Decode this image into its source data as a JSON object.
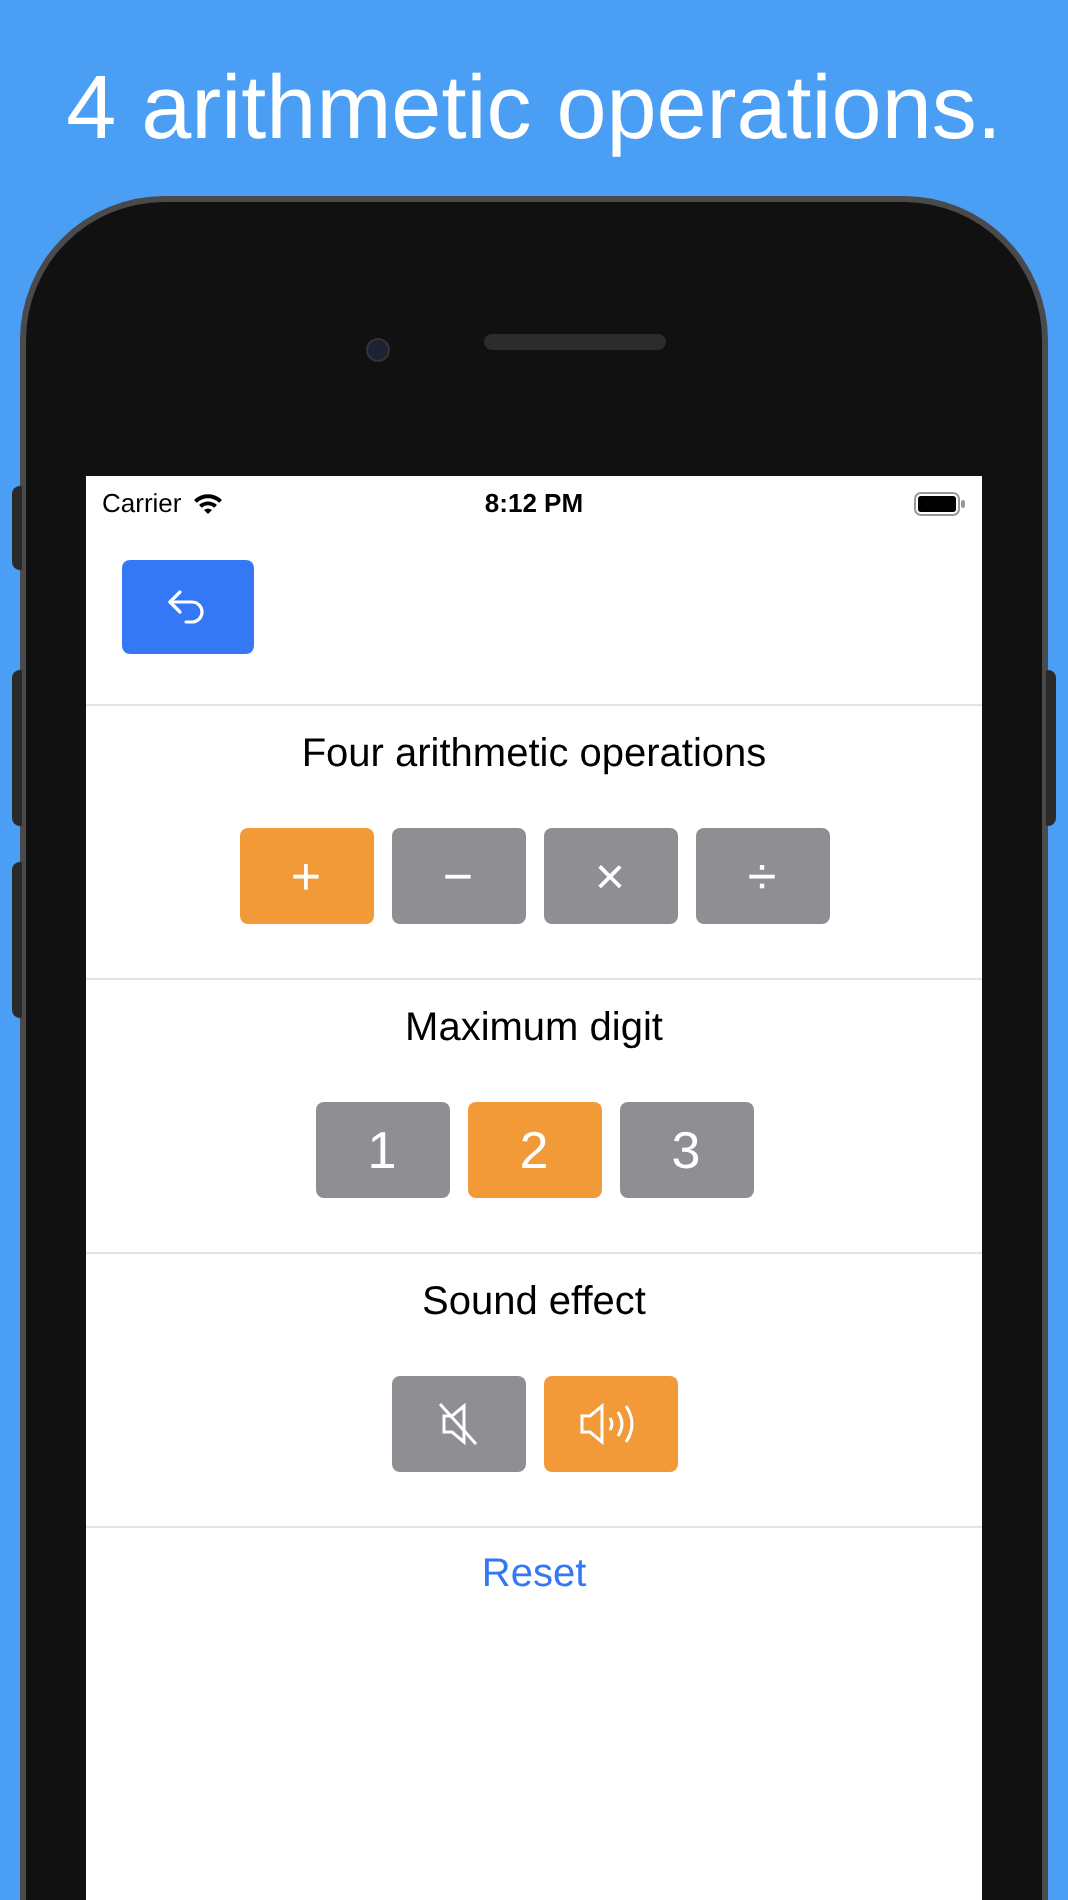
{
  "headline": "4 arithmetic operations.",
  "status_bar": {
    "carrier": "Carrier",
    "time": "8:12 PM"
  },
  "sections": [
    {
      "title": "Four arithmetic operations",
      "options": [
        {
          "kind": "text",
          "label": "+",
          "selected": true
        },
        {
          "kind": "text",
          "label": "−",
          "selected": false
        },
        {
          "kind": "text",
          "label": "×",
          "selected": false
        },
        {
          "kind": "text",
          "label": "÷",
          "selected": false
        }
      ]
    },
    {
      "title": "Maximum digit",
      "options": [
        {
          "kind": "text",
          "label": "1",
          "selected": false
        },
        {
          "kind": "text",
          "label": "2",
          "selected": true
        },
        {
          "kind": "text",
          "label": "3",
          "selected": false
        }
      ]
    },
    {
      "title": "Sound effect",
      "options": [
        {
          "kind": "mute",
          "selected": false
        },
        {
          "kind": "sound",
          "selected": true
        }
      ]
    }
  ],
  "reset": "Reset"
}
